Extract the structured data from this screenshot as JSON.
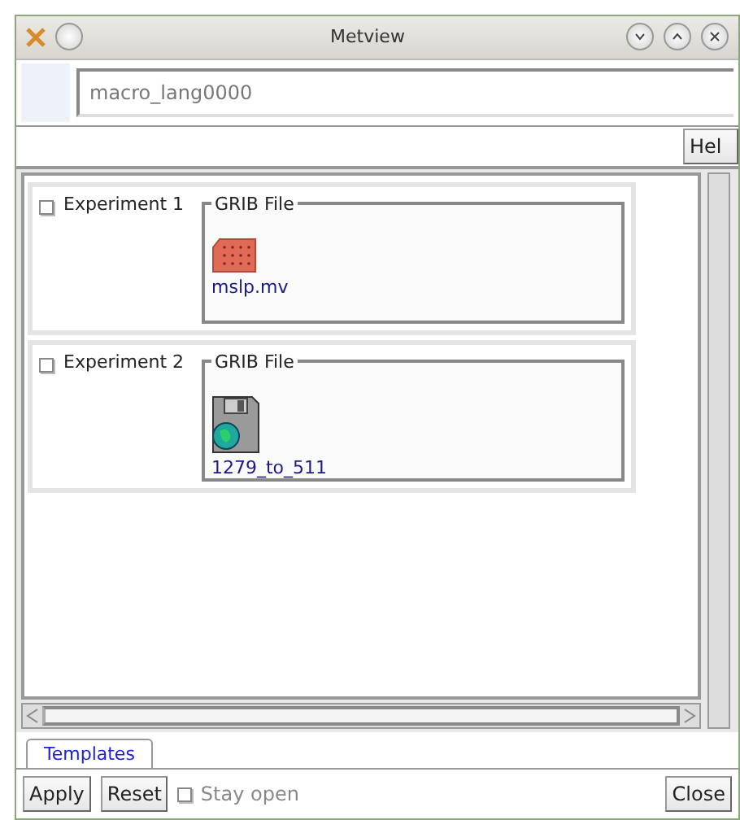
{
  "window": {
    "title": "Metview"
  },
  "name_field": {
    "value": "macro_lang0000"
  },
  "help_button": "Hel",
  "experiments": [
    {
      "label": "Experiment 1",
      "checked": false,
      "group": "GRIB File",
      "file": {
        "name": "mslp.mv",
        "kind": "grid"
      }
    },
    {
      "label": "Experiment 2",
      "checked": false,
      "group": "GRIB File",
      "file": {
        "name": "1279_to_511",
        "kind": "disk"
      }
    }
  ],
  "tabs": [
    {
      "label": "Templates",
      "selected": true
    }
  ],
  "buttons": {
    "apply": "Apply",
    "reset": "Reset",
    "stay_open": {
      "label": "Stay open",
      "checked": false
    },
    "close": "Close"
  }
}
